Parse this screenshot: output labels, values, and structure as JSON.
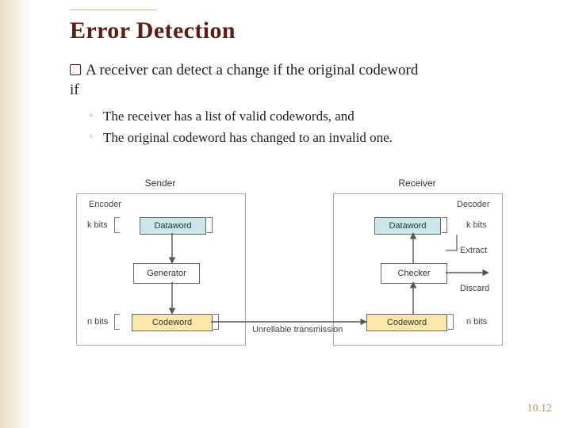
{
  "title": "Error Detection",
  "bullet": {
    "checkbox_icon": "checkbox-icon",
    "line1_part1": "A receiver can detect a change if the original codeword",
    "line2": "if"
  },
  "subbullets": [
    "The receiver has a list of valid codewords, and",
    "The original codeword has changed to an invalid one."
  ],
  "diagram": {
    "sender_caption": "Sender",
    "receiver_caption": "Receiver",
    "encoder_label": "Encoder",
    "decoder_label": "Decoder",
    "k_bits": "k bits",
    "n_bits": "n bits",
    "dataword": "Dataword",
    "generator": "Generator",
    "codeword": "Codeword",
    "checker": "Checker",
    "extract": "Extract",
    "discard": "Discard",
    "unreliable": "Unreliable transmission"
  },
  "page_number": "10.12"
}
